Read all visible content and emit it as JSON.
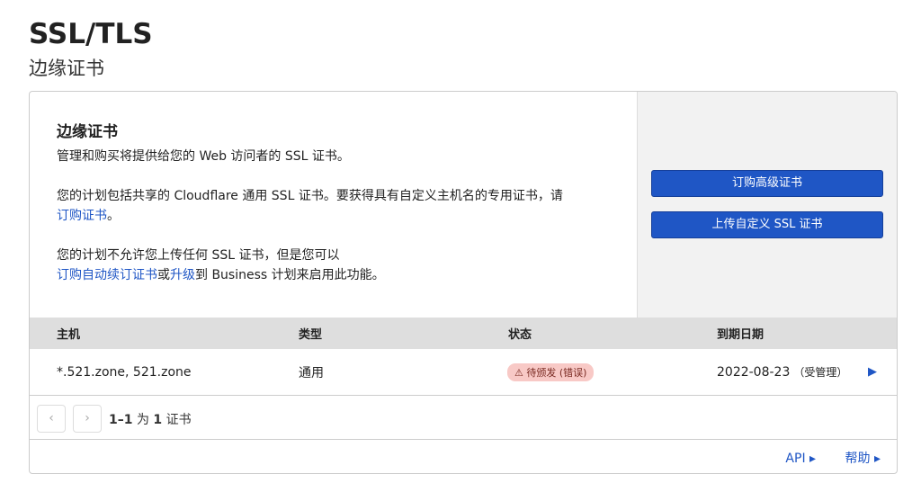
{
  "page": {
    "title": "SSL/TLS",
    "subtitle": "边缘证书"
  },
  "card": {
    "title": "边缘证书",
    "p1": "管理和购买将提供给您的 Web 访问者的 SSL 证书。",
    "p2": "您的计划包括共享的 Cloudflare 通用 SSL 证书。要获得具有自定义主机名的专用证书，请",
    "p2_link": "订购证书",
    "p2_end": "。",
    "p3": "您的计划不允许您上传任何 SSL 证书，但是您可以",
    "p3_link1": "订购自动续订证书",
    "p3_or": "或",
    "p3_link2": "升级",
    "p3_end": "到 Business 计划来启用此功能。",
    "buttons": {
      "order": "订购高级证书",
      "upload": "上传自定义 SSL 证书"
    }
  },
  "table": {
    "headers": [
      "主机",
      "类型",
      "状态",
      "到期日期"
    ],
    "rows": [
      {
        "host": "*.521.zone, 521.zone",
        "type": "通用",
        "status": "待颁发 (错误)",
        "expiry": "2022-08-23",
        "managed": "（受管理）"
      }
    ]
  },
  "pager": {
    "summary_range": "1–1",
    "summary_of": "为",
    "summary_total": "1",
    "summary_unit": "证书"
  },
  "footer": {
    "api": "API",
    "help": "帮助"
  }
}
